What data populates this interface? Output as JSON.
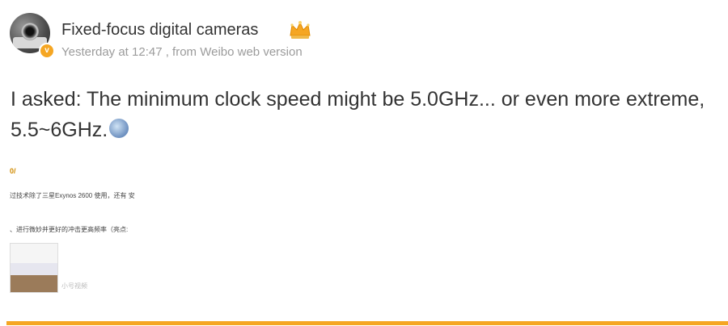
{
  "post": {
    "username": "Fixed-focus digital cameras",
    "timestamp": "Yesterday at 12:47",
    "source": ", from Weibo web version",
    "text": "I asked: The minimum clock speed might be 5.0GHz... or even more extreme, 5.5~6GHz."
  },
  "embed": {
    "tag": "0/",
    "line1": "过技术除了三星Exynos 2600 使用，还有 安",
    "line2": "、进行微妙并更好的冲击更高频率（亮点:",
    "caption": "小号视频"
  },
  "icons": {
    "crown": "crown-icon",
    "verified": "verified-badge-icon",
    "emoji": "shocked-face-emoji"
  },
  "colors": {
    "accent": "#f5a623",
    "meta": "#9b9b9b"
  }
}
